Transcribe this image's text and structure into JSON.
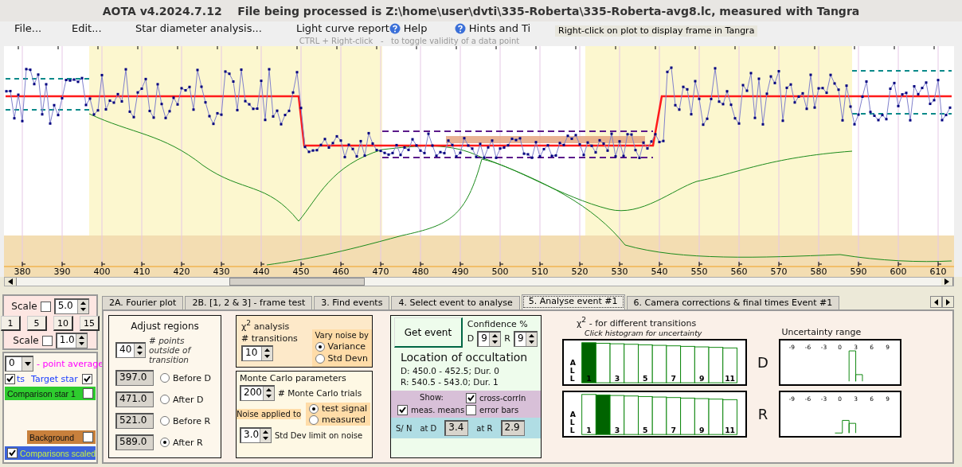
{
  "window": {
    "title": "AOTA v4.2024.7.12    File being processed is Z:\\home\\user\\dvti\\335-Roberta\\335-Roberta-avg8.lc, measured with Tangra"
  },
  "menu": [
    {
      "label": "File...",
      "kind": "plain"
    },
    {
      "label": "Edit...",
      "kind": "plain"
    },
    {
      "label": "Star diameter analysis...",
      "kind": "plain"
    },
    {
      "label": "Light curve report",
      "kind": "plain"
    },
    {
      "label": "Help",
      "kind": "help"
    },
    {
      "label": "Hints and Ti",
      "kind": "help"
    }
  ],
  "tooltip": "Right-click on plot to display frame in Tangra",
  "hint": "CTRL + Right-click   -   to toggle validity of a data point",
  "plot": {
    "x_tick_labels": [
      "380",
      "390",
      "400",
      "410",
      "420",
      "430",
      "440",
      "450",
      "460",
      "470",
      "480",
      "490",
      "500",
      "510",
      "520",
      "530",
      "540",
      "550",
      "560",
      "570",
      "580",
      "590",
      "600",
      "610"
    ]
  },
  "left_panel": {
    "scale_1": {
      "label": "Scale",
      "checked": false,
      "value": "5.0"
    },
    "zoom_buttons": [
      "1",
      "5",
      "10",
      "15"
    ],
    "scale_2": {
      "label": "Scale",
      "checked": false,
      "value": "1.0"
    },
    "average": {
      "value": "0",
      "label": "- point average"
    },
    "target": {
      "prefix_checked": true,
      "prefix": "ts",
      "label": "Target star",
      "checked": true
    },
    "series": [
      {
        "label": "Comparison star 1",
        "checked": false,
        "color": "#2ecc2e"
      },
      {
        "label": "Background",
        "checked": false,
        "color": "#c8803c"
      },
      {
        "label": "Comparisons scaled",
        "checked": true,
        "color": "#3c64dc"
      }
    ]
  },
  "tabs": [
    {
      "label": "2A. Fourier plot",
      "selected": false
    },
    {
      "label": "2B. [1, 2 & 3] - frame test",
      "selected": false
    },
    {
      "label": "3. Find events",
      "selected": false
    },
    {
      "label": "4. Select event to analyse",
      "selected": false
    },
    {
      "label": "5. Analyse event #1",
      "selected": true
    },
    {
      "label": "6. Camera corrections & final times Event #1",
      "selected": false
    }
  ],
  "adjust_regions": {
    "title": "Adjust regions",
    "points": "40",
    "points_label": "# points outside of transition",
    "regions": [
      {
        "value": "397.0",
        "label": "Before D",
        "selected": false
      },
      {
        "value": "471.0",
        "label": "After D",
        "selected": false
      },
      {
        "value": "521.0",
        "label": "Before R",
        "selected": false
      },
      {
        "value": "589.0",
        "label": "After R",
        "selected": true
      }
    ]
  },
  "chi2_analysis": {
    "title": "χ$^{2}$ analysis",
    "transitions_label": "# transitions",
    "transitions": "10",
    "vary_label": "Vary noise by",
    "options": [
      {
        "label": "Variance",
        "selected": true
      },
      {
        "label": "Std Devn",
        "selected": false
      }
    ]
  },
  "monte_carlo": {
    "title": "Monte Carlo parameters",
    "trials": "200",
    "trials_label": "# Monte Carlo trials",
    "noise_label": "Noise applied to",
    "options": [
      {
        "label": "test signal",
        "selected": true
      },
      {
        "label": "measured",
        "selected": false
      }
    ],
    "limit": "3.0",
    "limit_label": "Std Dev limit on noise"
  },
  "event": {
    "button": "Get event",
    "confidence_label": "Confidence %",
    "d_label": "D",
    "d_value": "9",
    "r_label": "R",
    "r_value": "9",
    "title": "Location of occultation",
    "lines": [
      "D: 450.0 - 452.5; Dur. 0",
      "R: 540.5 - 543.0; Dur. 1"
    ],
    "show_label": "Show:",
    "checks": [
      {
        "label": "meas. means",
        "checked": true
      },
      {
        "label": "cross-corrln",
        "checked": true
      },
      {
        "label": "error bars",
        "checked": false
      }
    ],
    "sn_label": "S/ N",
    "at_d_label": "at D",
    "at_d": "3.4",
    "at_r_label": "at R",
    "at_r": "2.9"
  },
  "transitions": {
    "title": "χ$^{2}$ -  for different transitions",
    "subtitle": "Click histogram for uncertainty",
    "uncertainty_title": "Uncertainty range",
    "histograms": [
      {
        "label": "D",
        "side_letters": [
          "A",
          "L",
          "L"
        ],
        "bar_labels": [
          "1",
          "3",
          "5",
          "7",
          "9",
          "11"
        ],
        "bars": [
          {
            "selected": true
          },
          {
            "selected": false
          },
          {
            "selected": false
          },
          {
            "selected": false
          },
          {
            "selected": false
          },
          {
            "selected": false
          },
          {
            "selected": false
          },
          {
            "selected": false
          },
          {
            "selected": false
          },
          {
            "selected": false
          },
          {
            "selected": false
          }
        ],
        "range_ticks": [
          "-9",
          "-6",
          "-3",
          "0",
          "3",
          "6",
          "9"
        ]
      },
      {
        "label": "R",
        "side_letters": [
          "A",
          "L",
          "L"
        ],
        "bar_labels": [
          "1",
          "3",
          "5",
          "7",
          "9",
          "11"
        ],
        "bars": [
          {
            "selected": false
          },
          {
            "selected": true
          },
          {
            "selected": false
          },
          {
            "selected": false
          },
          {
            "selected": false
          },
          {
            "selected": false
          },
          {
            "selected": false
          },
          {
            "selected": false
          },
          {
            "selected": false
          },
          {
            "selected": false
          },
          {
            "selected": false
          }
        ],
        "range_ticks": [
          "-9",
          "-6",
          "-3",
          "0",
          "3",
          "6",
          "9"
        ]
      }
    ]
  }
}
